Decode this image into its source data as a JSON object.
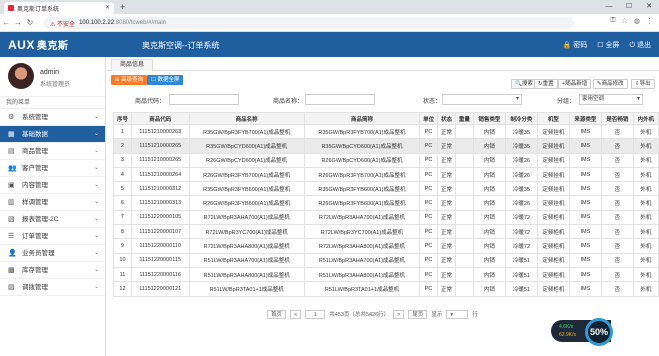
{
  "browser": {
    "tab_title": "奥克斯订单系统",
    "insecure_label": "不安全",
    "url_host": "100.100.2.22",
    "url_rest": ":8080/tcweb/#/main"
  },
  "header": {
    "logo": "AUX",
    "logo_cn": "奥克斯",
    "system_title": "奥克斯空调--订单系统",
    "password": "密码",
    "fullscreen": "全屏",
    "exit": "退出"
  },
  "user": {
    "name": "admin",
    "role": "系统管理员"
  },
  "sidebar": {
    "menu_title": "我的菜单",
    "items": [
      {
        "label": "系统管理",
        "active": false
      },
      {
        "label": "基础数据",
        "active": true
      },
      {
        "label": "商品管理",
        "active": false
      },
      {
        "label": "客户管理",
        "active": false
      },
      {
        "label": "内容管理",
        "active": false
      },
      {
        "label": "样调管理",
        "active": false
      },
      {
        "label": "报表管理-2C",
        "active": false
      },
      {
        "label": "订单管理",
        "active": false
      },
      {
        "label": "业务员管理",
        "active": false
      },
      {
        "label": "库存管理",
        "active": false
      },
      {
        "label": "调拨管理",
        "active": false
      }
    ]
  },
  "main": {
    "tab": "商品信息",
    "buttons": {
      "advanced": "高级查询",
      "full_data": "数据全屏",
      "search": "搜索",
      "reset": "重置",
      "add": "随品新增",
      "edit": "商品修改",
      "export": "导出"
    },
    "filters": {
      "code_label": "商品代码：",
      "name_label": "商品名称：",
      "status_label": "状态：",
      "group_label": "分组：",
      "group_value": "家用空调"
    },
    "columns": [
      "序号",
      "商品代码",
      "商品名称",
      "商品简称",
      "单位",
      "状态",
      "重量",
      "销售类型",
      "制冷分类",
      "机型",
      "来源类型",
      "是否畅销",
      "内外机"
    ],
    "rows": [
      [
        "1",
        "11151210000263",
        "R35GW/BpR3FYB700(A1)成品整机",
        "R35GW/BpR3FYB700(A1)成品整机",
        "PC",
        "正常",
        "",
        "内销",
        "冷暖35",
        "定频挂机",
        "IMS",
        "否",
        "外机"
      ],
      [
        "2",
        "11151210000265",
        "R35GW/BpCYD600(A1)成品整机",
        "R35GW/BpCYD600(A1)成品整机",
        "PC",
        "正常",
        "",
        "内销",
        "冷暖35",
        "定频挂机",
        "IMS",
        "否",
        "外机"
      ],
      [
        "3",
        "11151210000265",
        "R26GW/BpCYD600(A1)成品整机",
        "R26GW/BpCYD600(A1)成品整机",
        "PC",
        "正常",
        "",
        "内销",
        "冷暖26",
        "定频挂机",
        "IMS",
        "否",
        "外机"
      ],
      [
        "4",
        "11151210000264",
        "R26GW/BpR3FYB700(A1)成品整机",
        "R26GW/BpR3FYB700(A1)成品整机",
        "PC",
        "正常",
        "",
        "内销",
        "冷暖26",
        "定频挂机",
        "IMS",
        "否",
        "外机"
      ],
      [
        "5",
        "11151210000312",
        "R35GW/BpR3FYB600(A1)成品整机",
        "R35GW/BpR3FYB600(A1)成品整机",
        "PC",
        "正常",
        "",
        "内销",
        "冷暖35",
        "定频挂机",
        "IMS",
        "否",
        "外机"
      ],
      [
        "6",
        "11151210000313",
        "R26GW/BpR3FYB600(A1)成品整机",
        "R26GW/BpR3FYB600(A1)成品整机",
        "PC",
        "正常",
        "",
        "内销",
        "冷暖26",
        "定频挂机",
        "IMS",
        "否",
        "外机"
      ],
      [
        "7",
        "11151220000105",
        "R72LW/BpR3AHA700(A1)成品整机",
        "R72LW/BpR3AHA700(A1)成品整机",
        "PC",
        "正常",
        "",
        "内销",
        "冷暖72",
        "定频柜机",
        "IMS",
        "否",
        "外机"
      ],
      [
        "8",
        "11151220000107",
        "R72LW/BpR3YC700(A1)成品整机",
        "R72LW/BpR3YC700(A1)成品整机",
        "PC",
        "正常",
        "",
        "内销",
        "冷暖72",
        "定频柜机",
        "IMS",
        "否",
        "外机"
      ],
      [
        "9",
        "11151220000110",
        "R72LW/BpR3AHA800(A1)成品整机",
        "R72LW/BpR3AHA800(A1)成品整机",
        "PC",
        "正常",
        "",
        "内销",
        "冷暖72",
        "定频柜机",
        "IMS",
        "否",
        "外机"
      ],
      [
        "10",
        "11151220000115",
        "R51LW/BpR3AHA700(A1)成品整机",
        "R51LW/BpR3AHA700(A1)成品整机",
        "PC",
        "正常",
        "",
        "内销",
        "冷暖51",
        "定频柜机",
        "IMS",
        "否",
        "外机"
      ],
      [
        "11",
        "11151220000116",
        "R51LW/BpR3AHA800(A1)成品整机",
        "R51LW/BpR3AHA800(A1)成品整机",
        "PC",
        "正常",
        "",
        "内销",
        "冷暖51",
        "定频柜机",
        "IMS",
        "否",
        "外机"
      ],
      [
        "12",
        "11151220000121",
        "R51LW/BpR3TA01+1成品整机",
        "R51LW/BpR3TA01+1成品整机",
        "PC",
        "正常",
        "",
        "内销",
        "冷暖51",
        "定频柜机",
        "IMS",
        "否",
        "外机"
      ]
    ],
    "selected_row": 1
  },
  "pager": {
    "first": "首页",
    "prev": "<",
    "page": "1",
    "total": "共453页（总共5426行）",
    "next": ">",
    "last": "尾页",
    "show": "显示",
    "rows_suffix": "行"
  },
  "widget": {
    "up": "4.6K/s",
    "down": "62.9K/s",
    "percent": "50%"
  }
}
